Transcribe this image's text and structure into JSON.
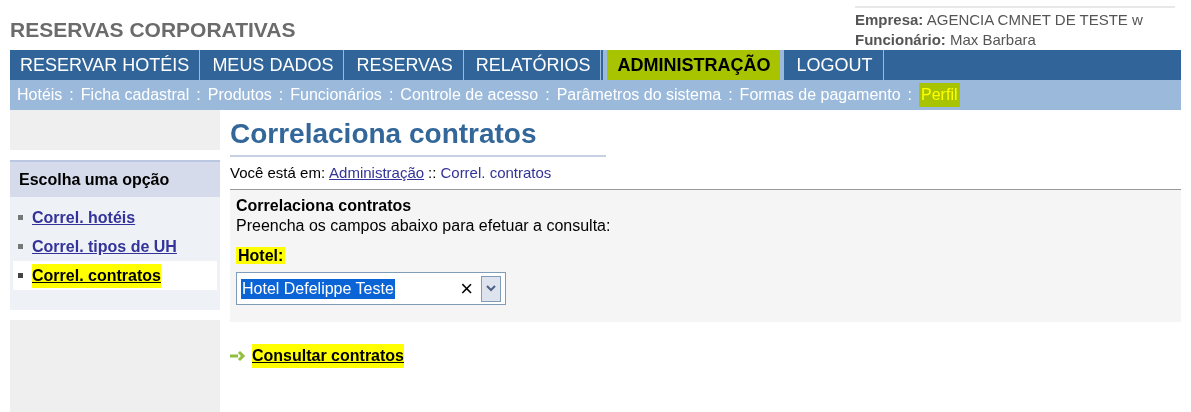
{
  "brand": "RESERVAS CORPORATIVAS",
  "user_info": [
    {
      "label": "Empresa:",
      "value": "AGENCIA CMNET DE TESTE w"
    },
    {
      "label": "Funcionário:",
      "value": "Max Barbara"
    }
  ],
  "main_nav": [
    {
      "label": "RESERVAR HOTÉIS",
      "selected": false
    },
    {
      "label": "MEUS DADOS",
      "selected": false
    },
    {
      "label": "RESERVAS",
      "selected": false
    },
    {
      "label": "RELATÓRIOS",
      "selected": false
    },
    {
      "label": "ADMINISTRAÇÃO",
      "selected": true
    },
    {
      "label": "LOGOUT",
      "selected": false
    }
  ],
  "sub_nav": [
    {
      "label": "Hotéis",
      "selected": false
    },
    {
      "label": "Ficha cadastral",
      "selected": false
    },
    {
      "label": "Produtos",
      "selected": false
    },
    {
      "label": "Funcionários",
      "selected": false
    },
    {
      "label": "Controle de acesso",
      "selected": false
    },
    {
      "label": "Parâmetros do sistema",
      "selected": false
    },
    {
      "label": "Formas de pagamento",
      "selected": false
    },
    {
      "label": "Perfil",
      "selected": true
    }
  ],
  "sub_nav_separator": ":",
  "sidebar": {
    "title": "Escolha uma opção",
    "items": [
      {
        "label": "Correl. hotéis",
        "selected": false
      },
      {
        "label": "Correl. tipos de UH",
        "selected": false
      },
      {
        "label": "Correl. contratos",
        "selected": true
      }
    ]
  },
  "page_title": "Correlaciona contratos",
  "breadcrumb": {
    "prefix": "Você está em:",
    "link": "Administração",
    "separator": "::",
    "current": "Correl. contratos"
  },
  "form": {
    "title": "Correlaciona contratos",
    "instructions": "Preencha os campos abaixo para efetuar a consulta:",
    "hotel_label": "Hotel:",
    "hotel_value": "Hotel Defelippe Teste",
    "clear_symbol": "×"
  },
  "action_link": "Consultar contratos"
}
